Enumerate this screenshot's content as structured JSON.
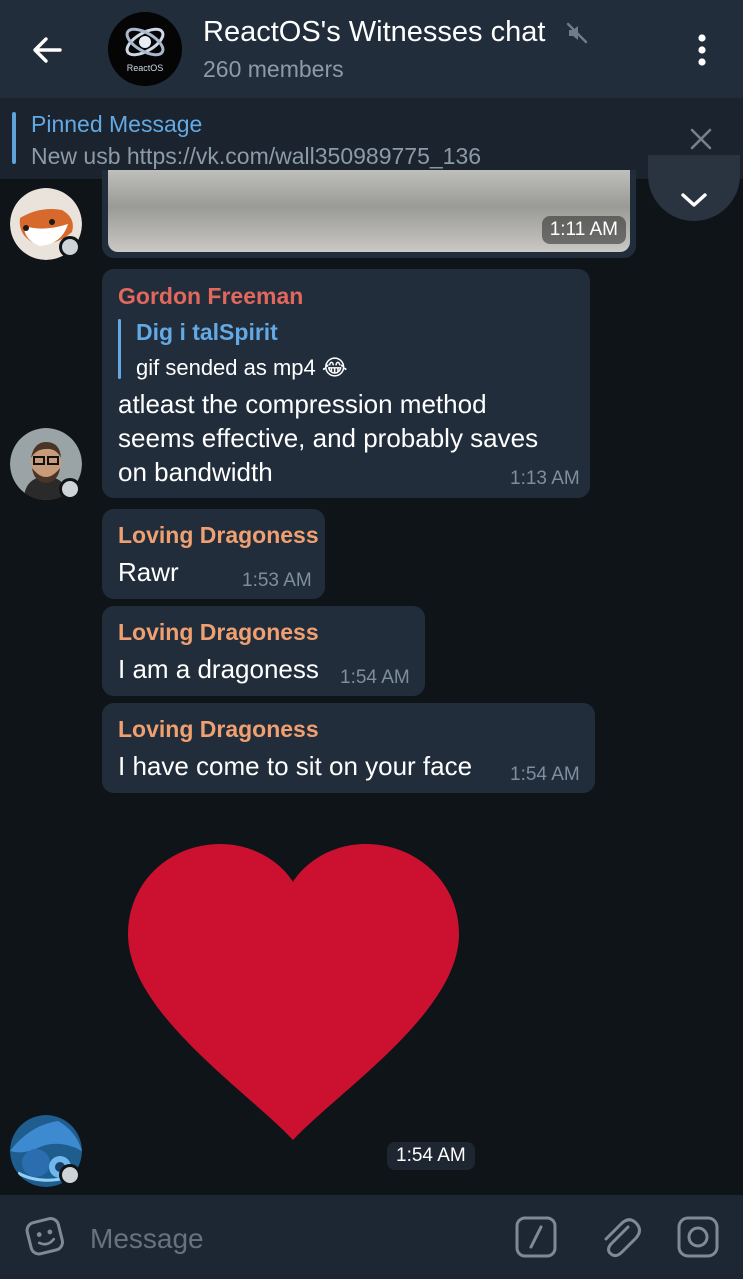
{
  "header": {
    "title": "ReactOS's Witnesses chat",
    "subtitle": "260 members",
    "avatar_text": "ReactOS"
  },
  "pinned": {
    "title": "Pinned Message",
    "text": "New usb https://vk.com/wall350989775_136"
  },
  "messages": [
    {
      "time": "1:11 AM"
    },
    {
      "sender": "Gordon Freeman",
      "reply_author": "Dig i talSpirit",
      "reply_text": "gif sended as mp4",
      "reply_emoji": "😂",
      "lines": [
        "atleast the compression method",
        "seems effective, and probably saves",
        "on bandwidth"
      ],
      "time": "1:13 AM"
    },
    {
      "sender": "Loving Dragoness",
      "text": "Rawr",
      "time": "1:53 AM"
    },
    {
      "sender": "Loving Dragoness",
      "text": "I am a dragoness",
      "time": "1:54 AM"
    },
    {
      "sender": "Loving Dragoness",
      "text": "I have come to sit on your face",
      "time": "1:54 AM"
    },
    {
      "time": "1:54 AM"
    }
  ],
  "input": {
    "placeholder": "Message"
  },
  "colors": {
    "accent": "#63a9e4",
    "sender_gordon": "#e2675c",
    "sender_dragoness": "#f0a070",
    "heart": "#cc1130",
    "bubble": "#212d3b"
  }
}
